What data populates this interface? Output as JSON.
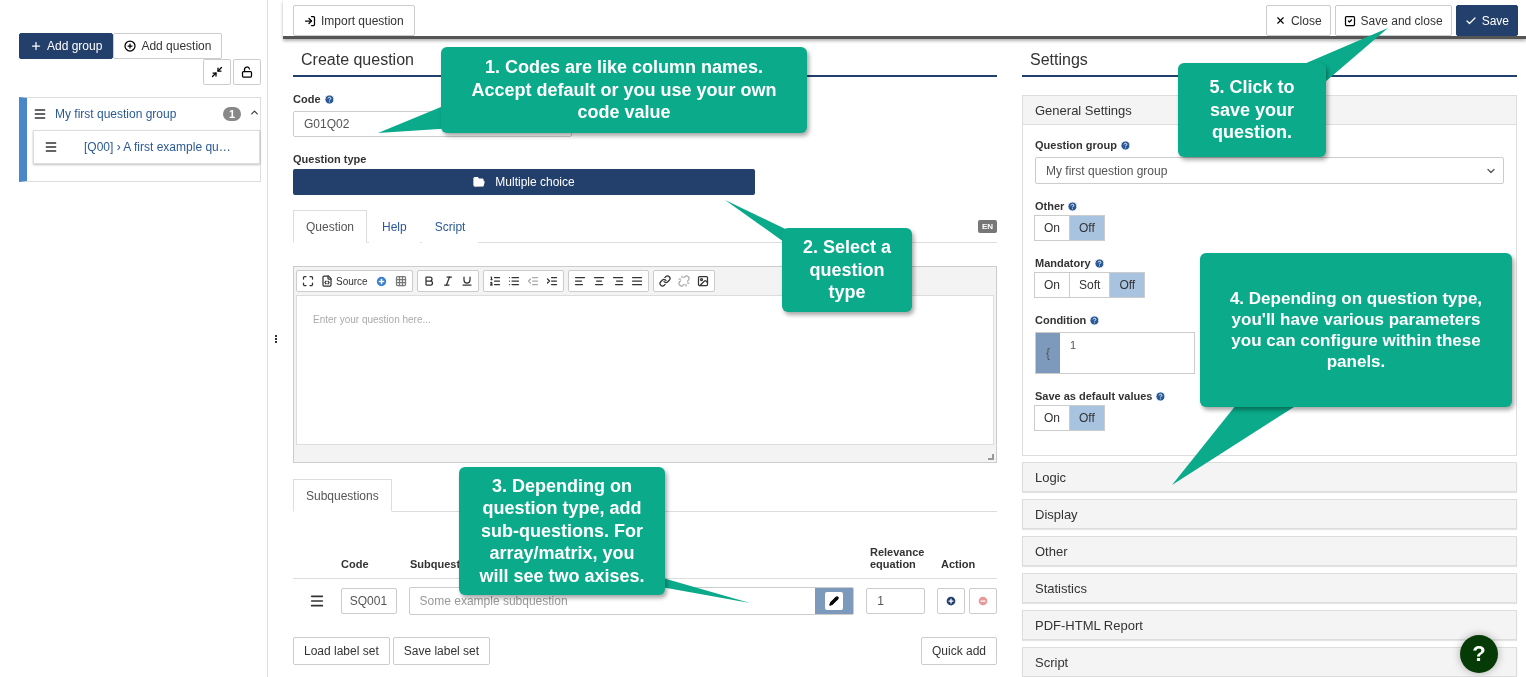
{
  "sidebar": {
    "add_group": "Add group",
    "add_question": "Add question",
    "tree": [
      {
        "label": "My first question group",
        "count": "1",
        "expanded": true,
        "children": [
          {
            "label": "[Q00] › A first example qu…"
          }
        ]
      }
    ]
  },
  "toolbar": {
    "import": "Import question",
    "close": "Close",
    "save_and_close": "Save and close",
    "save": "Save"
  },
  "create": {
    "title": "Create question",
    "code_label": "Code",
    "code_value": "G01Q02",
    "type_label": "Question type",
    "type_value": "Multiple choice",
    "tabs": [
      {
        "label": "Question",
        "selected": true
      },
      {
        "label": "Help",
        "selected": false
      },
      {
        "label": "Script",
        "selected": false
      }
    ],
    "language": "EN",
    "editor": {
      "source": "Source",
      "placeholder": "Enter your question here..."
    },
    "sub_tabs": [
      {
        "label": "Subquestions",
        "selected": true
      }
    ],
    "columns": [
      "Code",
      "Subquest",
      "Relevance equation",
      "Action"
    ],
    "rows": [
      {
        "code": "SQ001",
        "placeholder": "Some example subquestion",
        "relevance": "1"
      }
    ],
    "buttons": [
      "Load label set",
      "Save label set"
    ],
    "quick_add": "Quick add"
  },
  "settings": {
    "title": "Settings",
    "general": "General Settings",
    "group_label": "Question group",
    "group_value": "My first question group",
    "toggles": [
      {
        "label": "Other",
        "options": [
          {
            "label": "On",
            "selected": false
          },
          {
            "label": "Off",
            "selected": true
          }
        ]
      },
      {
        "label": "Mandatory",
        "options": [
          {
            "label": "On",
            "selected": false
          },
          {
            "label": "Soft",
            "selected": false
          },
          {
            "label": "Off",
            "selected": true
          }
        ]
      }
    ],
    "condition_label": "Condition",
    "condition_addon": "{",
    "condition_value": "1",
    "default_toggle": {
      "label": "Save as default values",
      "options": [
        {
          "label": "On",
          "selected": false
        },
        {
          "label": "Off",
          "selected": true
        }
      ]
    },
    "panels": [
      "Logic",
      "Display",
      "Other",
      "Statistics",
      "PDF-HTML Report",
      "Script"
    ]
  },
  "help": "?",
  "callouts": [
    {
      "text": "1. Codes are like column names. Accept default or you use your own code value"
    },
    {
      "text": "5. Click to save your question."
    },
    {
      "text": "2. Select a question type"
    },
    {
      "text": "4. Depending on question type, you'll have various parameters you can configure within these panels."
    },
    {
      "text": "3. Depending on question type, add sub-questions. For array/matrix, you will see two axises."
    }
  ]
}
